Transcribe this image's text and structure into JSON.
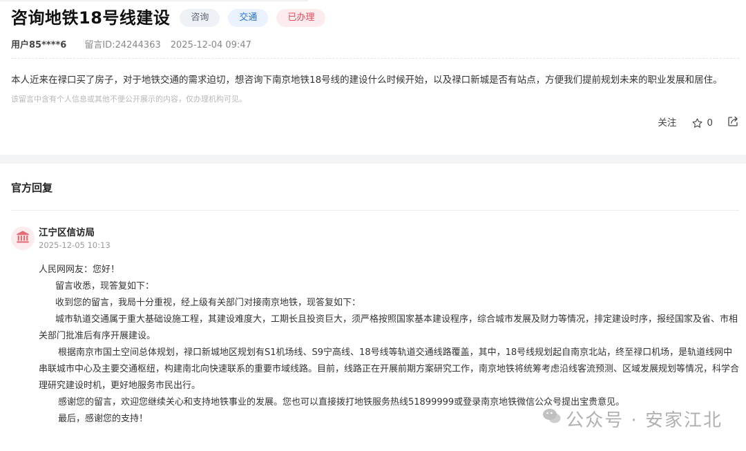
{
  "message": {
    "title": "咨询地铁18号线建设",
    "tags": {
      "type": "咨询",
      "field": "交通",
      "status": "已办理"
    },
    "user": "用户85****6",
    "id_text": "留言ID:24244363",
    "time": "2025-12-04 09:47",
    "content": "本人近来在禄口买了房子，对于地铁交通的需求迫切，想咨询下南京地铁18号线的建设什么时候开始，以及禄口新城是否有站点，方便我们提前规划未来的职业发展和居住。",
    "privacy_note": "该留言中含有个人信息或其他不便公开展示的内容，仅办理机构可见。",
    "actions": {
      "follow": "关注",
      "like_count": "0"
    }
  },
  "reply": {
    "heading": "官方回复",
    "department": "江宁区信访局",
    "time": "2025-12-05 10:13",
    "paragraphs": [
      "人民网网友：您好！",
      "留言收悉，现答复如下：",
      "收到您的留言，我局十分重视，经上级有关部门对接南京地铁，现答复如下：",
      "城市轨道交通属于重大基础设施工程，其建设难度大，工期长且投资巨大，须严格按照国家基本建设程序，综合城市发展及财力等情况，排定建设时序，报经国家及省、市相关部门批准后有序开展建设。",
      "根据南京市国土空间总体规划，禄口新城地区规划有S1机场线、S9宁高线、18号线等轨道交通线路覆盖，其中，18号线规划起自南京北站，终至禄口机场，是轨道线网中串联城市中心及主要交通枢纽，构建南北向快速联系的重要市域线路。目前，线路正在开展前期方案研究工作，南京地铁将统筹考虑沿线客流预测、区域发展规划等情况，科学合理研究建设时机，更好地服务市民出行。",
      "感谢您的留言，欢迎您继续关心和支持地铁事业的发展。您也可以直接拨打地铁服务热线51899999或登录南京地铁微信公众号提出宝贵意见。",
      "最后，感谢您的支持！"
    ]
  },
  "watermark": "公众号 · 安家江北",
  "colors": {
    "status_red": "#e04b5a",
    "field_blue": "#2b74d6",
    "avatar_bg": "#fdeced",
    "avatar_icon": "#e46a74"
  },
  "icons": [
    "star-icon",
    "share-icon",
    "government-building-icon",
    "wechat-icon"
  ]
}
